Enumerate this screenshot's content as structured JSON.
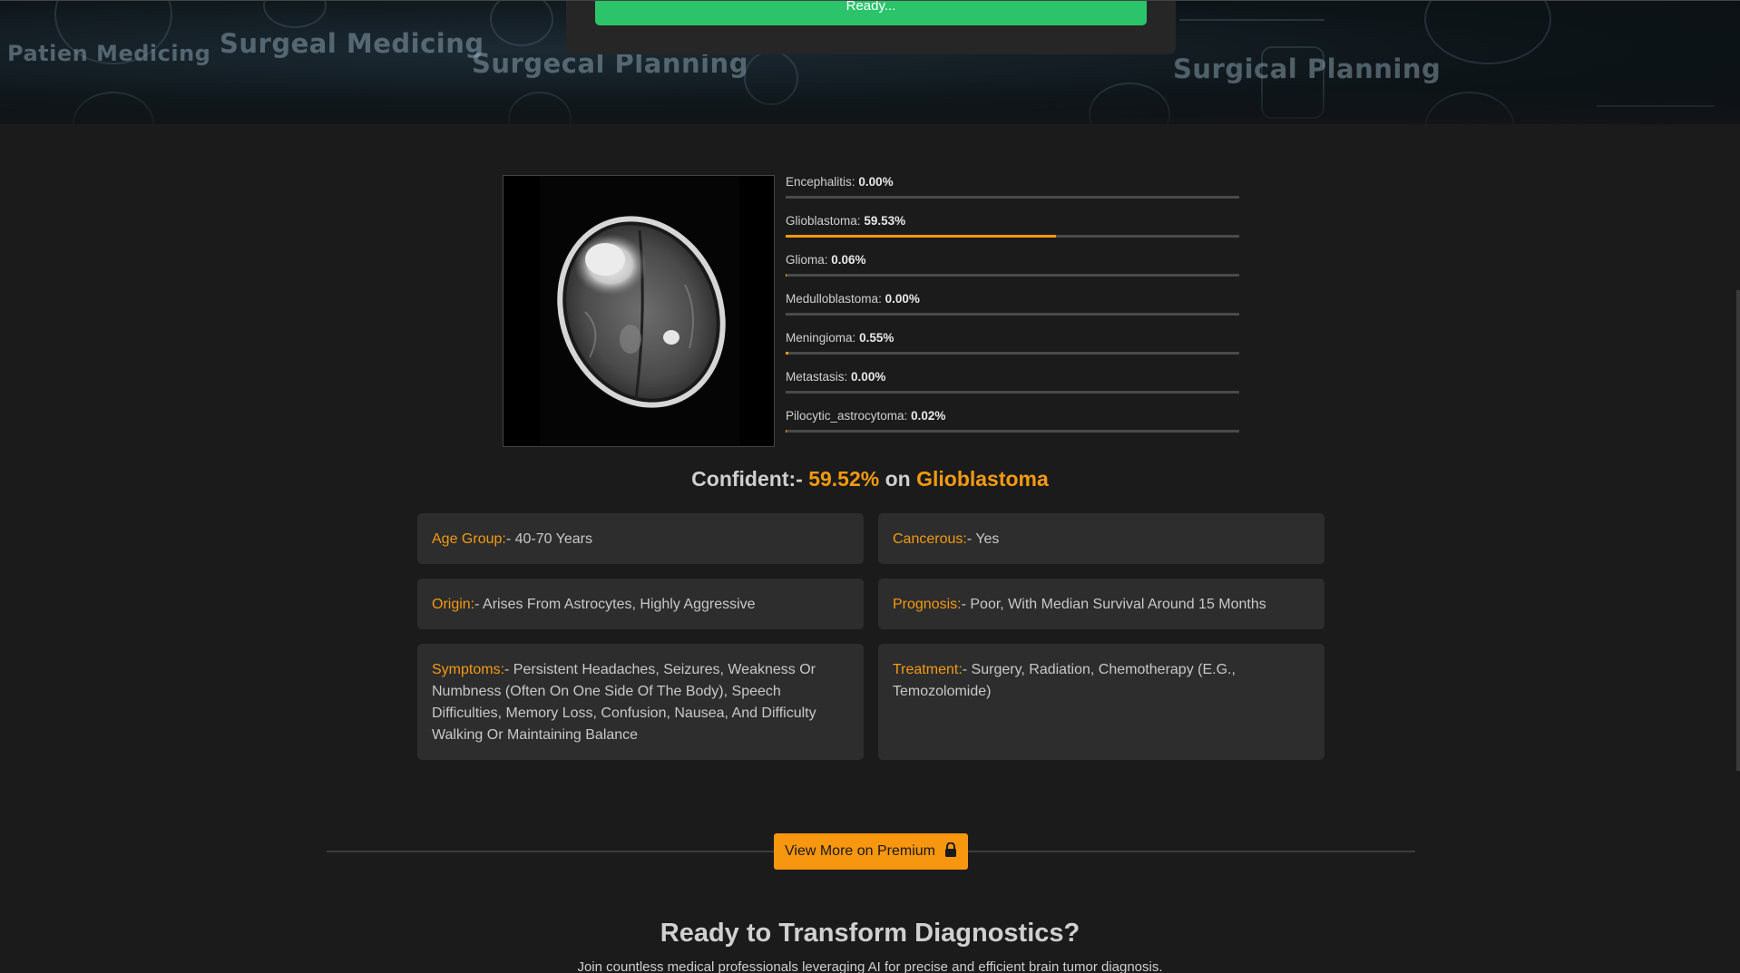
{
  "hero": {
    "banner_texts": [
      "Patien Medicing",
      "Surgeal Medicing",
      "Surgecal Planning",
      "Surgical Planning"
    ],
    "status_label": "Ready..."
  },
  "results": {
    "probabilities": [
      {
        "label": "Encephalitis",
        "value_text": "0.00%",
        "value": 0.0
      },
      {
        "label": "Glioblastoma",
        "value_text": "59.53%",
        "value": 59.53
      },
      {
        "label": "Glioma",
        "value_text": "0.06%",
        "value": 0.06
      },
      {
        "label": "Medulloblastoma",
        "value_text": "0.00%",
        "value": 0.0
      },
      {
        "label": "Meningioma",
        "value_text": "0.55%",
        "value": 0.55
      },
      {
        "label": "Metastasis",
        "value_text": "0.00%",
        "value": 0.0
      },
      {
        "label": "Pilocytic_astrocytoma",
        "value_text": "0.02%",
        "value": 0.02
      }
    ],
    "confident": {
      "prefix": "Confident:-",
      "percent": "59.52%",
      "on": "on",
      "diagnosis": "Glioblastoma"
    },
    "info": {
      "age_group": {
        "key": "Age Group:",
        "value": "- 40-70 Years"
      },
      "cancerous": {
        "key": "Cancerous:",
        "value": "- Yes"
      },
      "origin": {
        "key": "Origin:",
        "value": "- Arises From Astrocytes, Highly Aggressive"
      },
      "prognosis": {
        "key": "Prognosis:",
        "value": "- Poor, With Median Survival Around 15 Months"
      },
      "symptoms": {
        "key": "Symptoms:",
        "value": "- Persistent Headaches, Seizures, Weakness Or Numbness (Often On One Side Of The Body), Speech Difficulties, Memory Loss, Confusion, Nausea, And Difficulty Walking Or Maintaining Balance"
      },
      "treatment": {
        "key": "Treatment:",
        "value": "- Surgery, Radiation, Chemotherapy (E.G., Temozolomide)"
      }
    }
  },
  "premium": {
    "button_label": "View More on Premium",
    "icon": "lock-icon"
  },
  "cta": {
    "title": "Ready to Transform Diagnostics?",
    "subtitle": "Join countless medical professionals leveraging AI for precise and efficient brain tumor diagnosis."
  },
  "colors": {
    "accent": "#f39a12",
    "success": "#2cc46a",
    "background": "#1b1b1b",
    "card": "#2d2d2d"
  }
}
